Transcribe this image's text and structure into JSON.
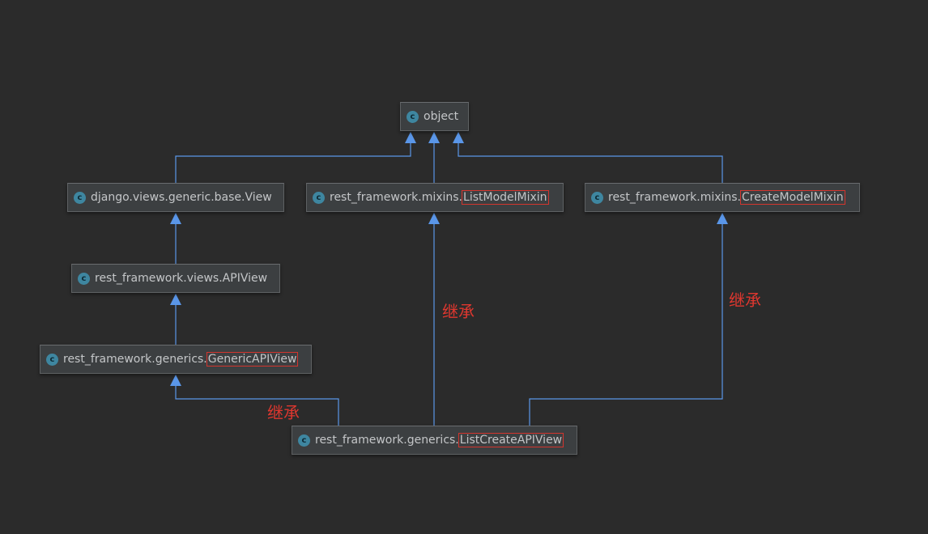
{
  "nodes": {
    "object": {
      "icon": "class-icon",
      "icon_letter": "c",
      "prefix": "object",
      "highlight": ""
    },
    "django_view": {
      "icon": "class-icon",
      "icon_letter": "c",
      "prefix": "django.views.generic.base.View",
      "highlight": ""
    },
    "list_model_mixin": {
      "icon": "class-icon",
      "icon_letter": "c",
      "prefix": "rest_framework.mixins.",
      "highlight": "ListModelMixin"
    },
    "create_model_mixin": {
      "icon": "class-icon",
      "icon_letter": "c",
      "prefix": "rest_framework.mixins.",
      "highlight": "CreateModelMixin"
    },
    "api_view": {
      "icon": "class-icon",
      "icon_letter": "c",
      "prefix": "rest_framework.views.APIView",
      "highlight": ""
    },
    "generic_api_view": {
      "icon": "class-icon",
      "icon_letter": "c",
      "prefix": "rest_framework.generics.",
      "highlight": "GenericAPIView"
    },
    "list_create_api_view": {
      "icon": "class-icon",
      "icon_letter": "c",
      "prefix": "rest_framework.generics.",
      "highlight": "ListCreateAPIView"
    }
  },
  "annotations": {
    "inherit_left": "继承",
    "inherit_middle": "继承",
    "inherit_right": "继承"
  },
  "colors": {
    "background": "#2b2b2b",
    "edge": "#5a96e8",
    "highlight_box": "#d3352e",
    "annotation_text": "#e0372f",
    "node_fill": "#3c3f41"
  }
}
